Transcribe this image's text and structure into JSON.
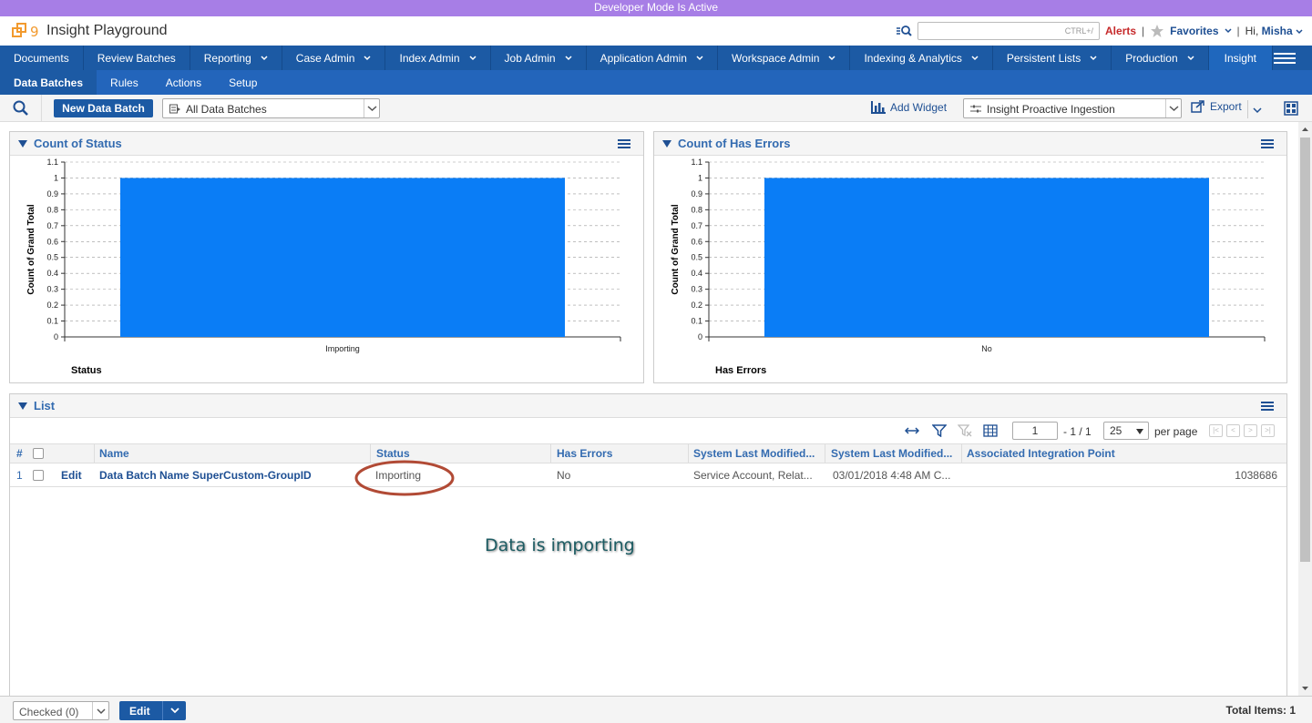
{
  "banner": "Developer Mode Is Active",
  "header": {
    "workspace": "Insight Playground",
    "search_hint": "CTRL+/",
    "alerts": "Alerts",
    "favorites": "Favorites",
    "greeting": "Hi, ",
    "user": "Misha"
  },
  "main_tabs": [
    "Documents",
    "Review Batches",
    "Reporting",
    "Case Admin",
    "Index Admin",
    "Job Admin",
    "Application Admin",
    "Workspace Admin",
    "Indexing & Analytics",
    "Persistent Lists",
    "Production",
    "Insight"
  ],
  "sub_tabs": [
    "Data Batches",
    "Rules",
    "Actions",
    "Setup"
  ],
  "toolbar": {
    "new_button": "New Data Batch",
    "view_select": "All Data Batches",
    "add_widget": "Add Widget",
    "dashboard_select": "Insight Proactive Ingestion",
    "export": "Export"
  },
  "widgets": [
    {
      "title": "Count of Status",
      "ylabel": "Count of Grand Total",
      "xlabel": "Status"
    },
    {
      "title": "Count of Has Errors",
      "ylabel": "Count of Grand Total",
      "xlabel": "Has Errors"
    }
  ],
  "chart_data": [
    {
      "type": "bar",
      "categories": [
        "Importing"
      ],
      "values": [
        1
      ],
      "xlabel": "Status",
      "ylabel": "Count of Grand Total",
      "ylim": [
        0,
        1.1
      ],
      "yticks": [
        "0",
        "0.1",
        "0.2",
        "0.3",
        "0.4",
        "0.5",
        "0.6",
        "0.7",
        "0.8",
        "0.9",
        "1",
        "1.1"
      ],
      "grid": true,
      "color": "#0a7df6"
    },
    {
      "type": "bar",
      "categories": [
        "No"
      ],
      "values": [
        1
      ],
      "xlabel": "Has Errors",
      "ylabel": "Count of Grand Total",
      "ylim": [
        0,
        1.1
      ],
      "yticks": [
        "0",
        "0.1",
        "0.2",
        "0.3",
        "0.4",
        "0.5",
        "0.6",
        "0.7",
        "0.8",
        "0.9",
        "1",
        "1.1"
      ],
      "grid": true,
      "color": "#0a7df6"
    }
  ],
  "list": {
    "title": "List",
    "page": "1",
    "page_of": "- 1 / 1",
    "per_page_value": "25",
    "per_page_label": "per page",
    "columns": [
      "#",
      "Name",
      "Status",
      "Has Errors",
      "System Last Modified...",
      "System Last Modified...",
      "Associated Integration Point"
    ],
    "rows": [
      {
        "num": "1",
        "edit": "Edit",
        "name": "Data Batch Name SuperCustom-GroupID",
        "status": "Importing",
        "has_errors": "No",
        "modified_by": "Service Account, Relat...",
        "modified_on": "03/01/2018 4:48 AM C...",
        "integration_point": "",
        "artifact_id": "1038686"
      }
    ]
  },
  "annotation": "Data is importing",
  "footer": {
    "checked": "Checked (0)",
    "edit": "Edit",
    "total": "Total Items: 1"
  },
  "colors": {
    "nav": "#1c5aa4",
    "subnav": "#2365bb",
    "banner": "#a77ee6",
    "bar": "#0a7df6",
    "link": "#1e4f93",
    "alert": "#c6292a"
  }
}
